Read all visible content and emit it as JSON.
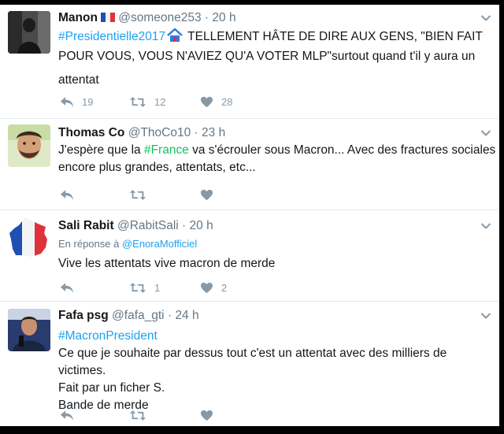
{
  "tweets": [
    {
      "name": "Manon",
      "handle": "@someone253",
      "sep": "·",
      "time": "20 h",
      "text_tag": "#Presidentielle2017",
      "text_rest_1": " TELLEMENT HÂTE DE DIRE AUX GENS, \"BIEN FAIT",
      "text_line2": "POUR VOUS, VOUS N'AVIEZ QU'A VOTER MLP\"surtout quand t'il y aura un",
      "text_line3": "attentat",
      "replies": "19",
      "retweets": "12",
      "likes": "28"
    },
    {
      "name": "Thomas Co",
      "handle": "@ThoCo10",
      "sep": "·",
      "time": "23 h",
      "text_pre": "J'espère que la ",
      "text_tag": "#France",
      "text_rest_1": " va s'écrouler sous Macron... Avec des fractures sociales",
      "text_line2": "encore plus grandes, attentats, etc...",
      "replies": "",
      "retweets": "",
      "likes": ""
    },
    {
      "name": "Sali Rabit",
      "handle": "@RabitSali",
      "sep": "·",
      "time": "20 h",
      "reply_prefix": "En réponse à",
      "reply_mention": "@EnoraMofficiel",
      "text_line1": "Vive les  attentats vive macron de merde",
      "replies": "",
      "retweets": "1",
      "likes": "2"
    },
    {
      "name": "Fafa psg",
      "handle": "@fafa_gti",
      "sep": "·",
      "time": "24 h",
      "text_tag": "#MacronPresident",
      "text_line2": "Ce que je souhaite par dessus tout c'est un attentat avec des milliers de victimes.",
      "text_line3": "Fait par un ficher S.",
      "text_line4": "Bande de merde",
      "replies": "",
      "retweets": "",
      "likes": ""
    }
  ],
  "icons": {
    "reply": "reply-icon",
    "retweet": "retweet-icon",
    "like": "heart-icon",
    "more": "chevron-down-icon",
    "flag": "french-flag-icon",
    "house": "house-emoji-icon"
  },
  "colors": {
    "link": "#1da1f2",
    "hashtag_green": "#17bf63",
    "text": "#14171a",
    "muted": "#657786",
    "icon": "#8899a6",
    "border": "#e1e8ed"
  }
}
